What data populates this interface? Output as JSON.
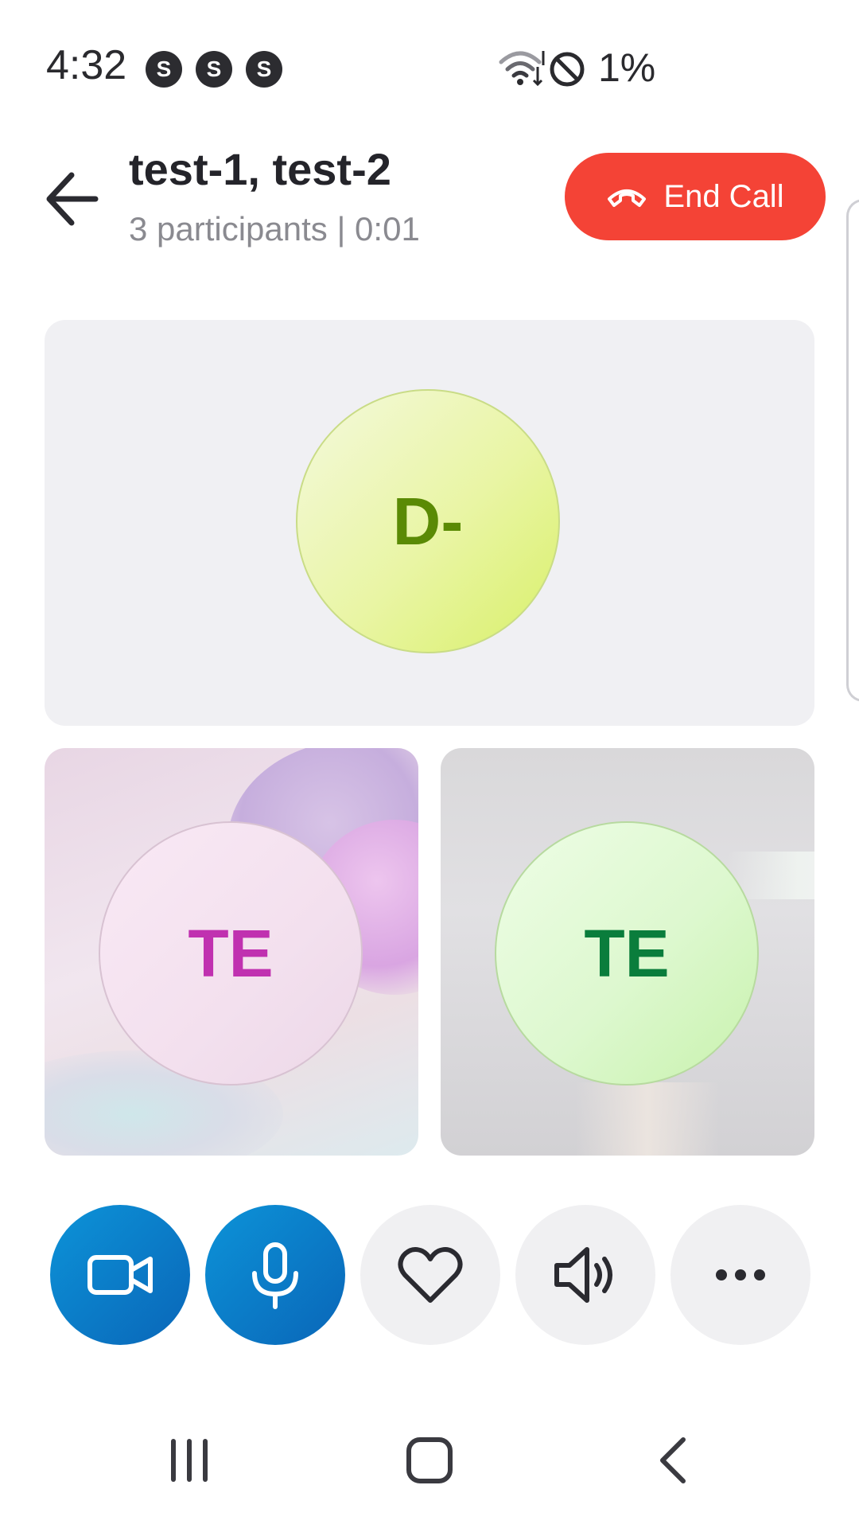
{
  "status_bar": {
    "time": "4:32",
    "notification_icons": [
      "S",
      "S",
      "S"
    ],
    "battery": "1%"
  },
  "header": {
    "title": "test-1, test-2",
    "subtitle": "3 participants | 0:01",
    "end_call_label": "End Call"
  },
  "participants": {
    "main": {
      "initials": "D-",
      "text_color": "#5a8a05"
    },
    "left": {
      "initials": "TE",
      "text_color": "#c031b0"
    },
    "right": {
      "initials": "TE",
      "text_color": "#0a7d3c"
    }
  },
  "controls": {
    "icons": [
      "video-camera-icon",
      "microphone-icon",
      "heart-icon",
      "speaker-icon",
      "more-icon"
    ],
    "active_color": "#0a78c8"
  },
  "colors": {
    "end_call": "#f44336",
    "tile_background": "#f0f0f3"
  }
}
